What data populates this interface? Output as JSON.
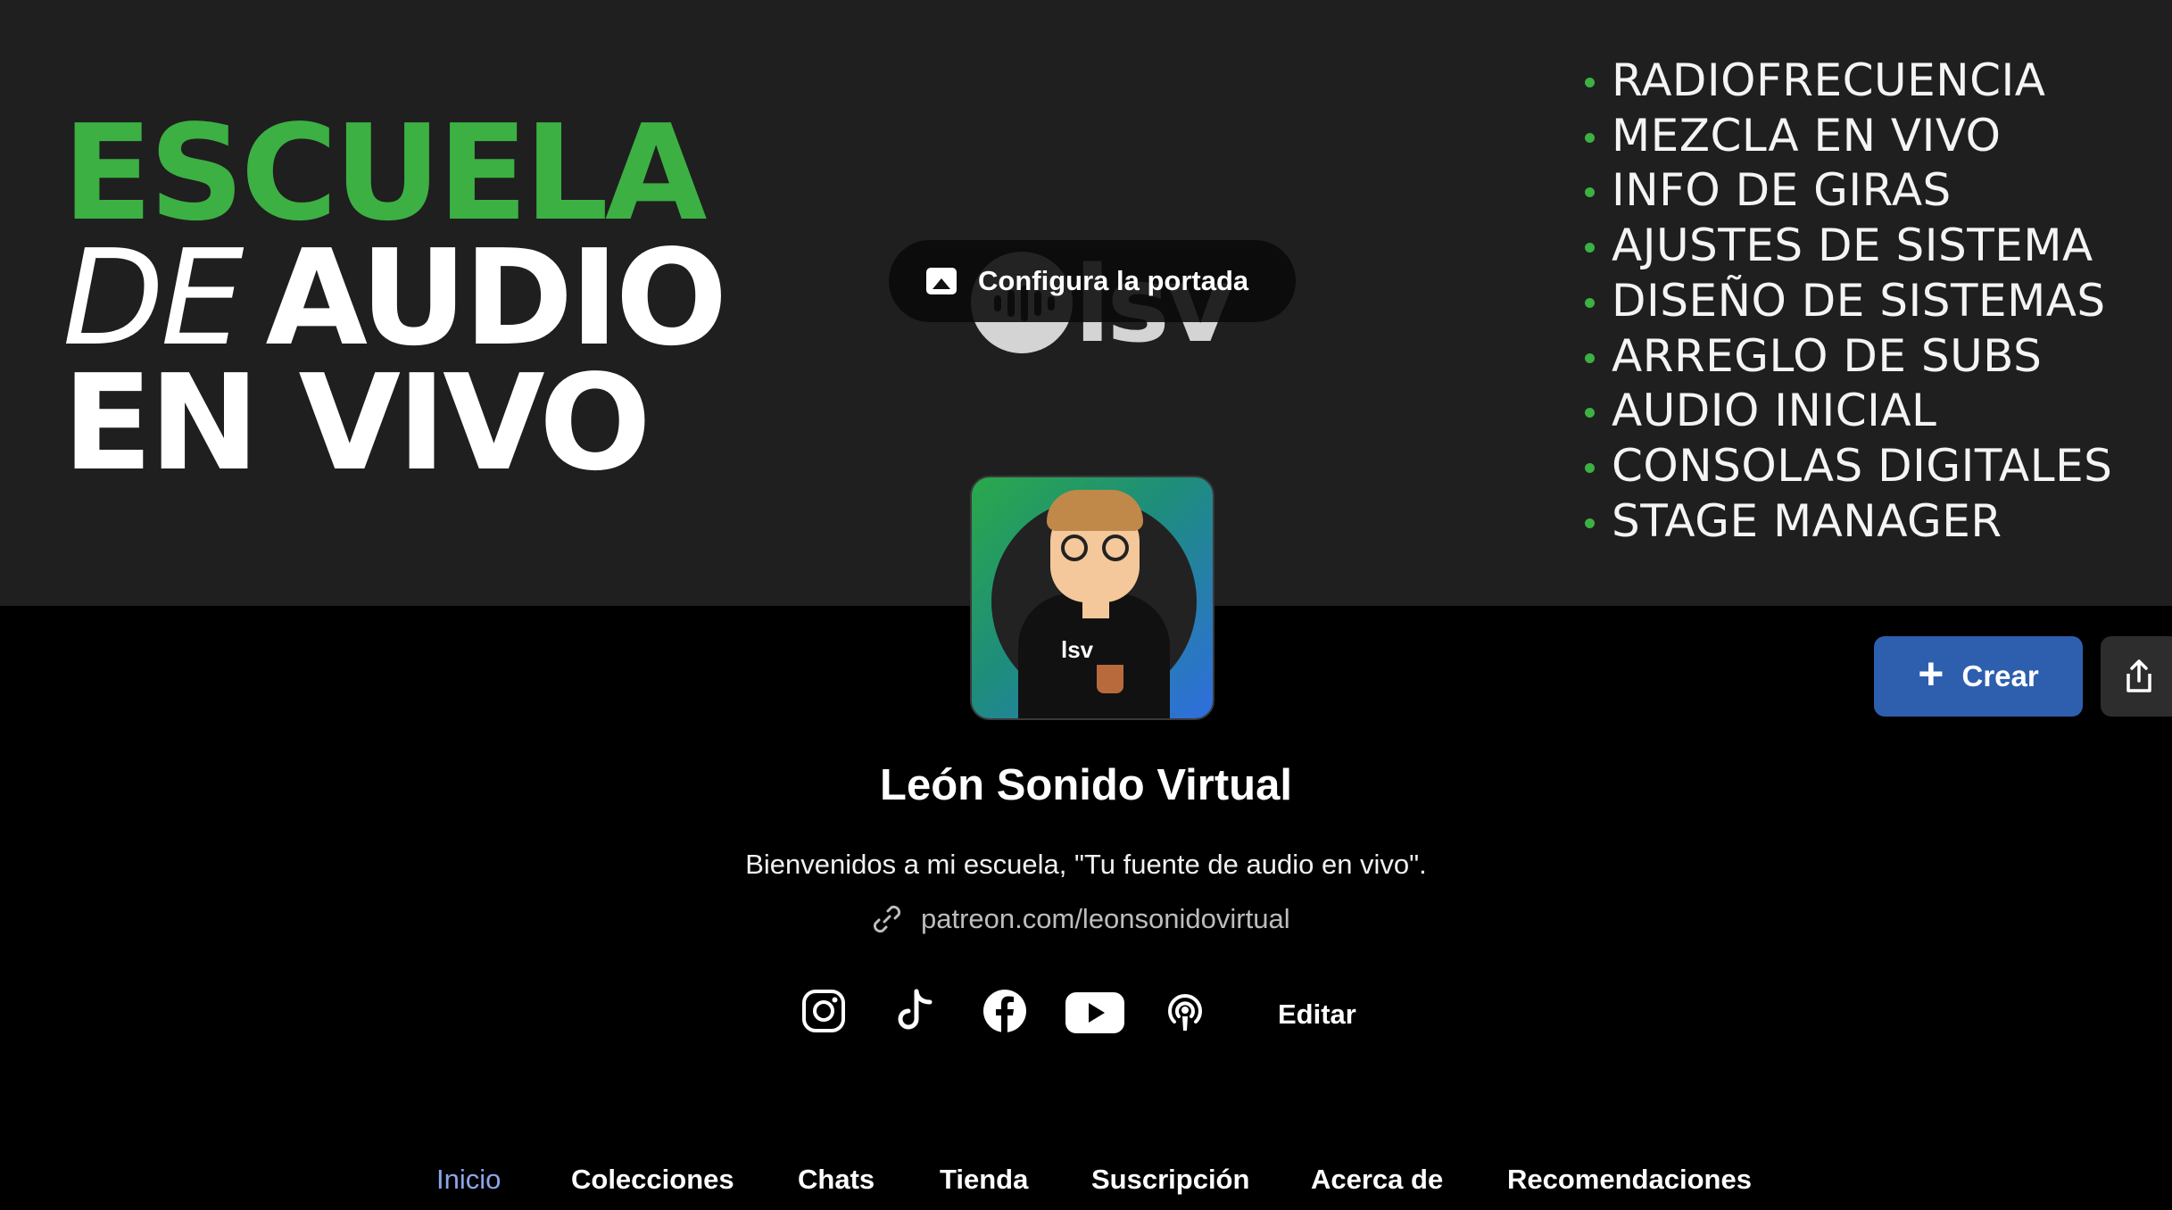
{
  "cover": {
    "title_line1": "ESCUELA",
    "title_line2_italic": "DE",
    "title_line2_rest": "AUDIO",
    "title_line3": "EN VIVO",
    "logo_text": "lsv",
    "topics": [
      "RADIOFRECUENCIA",
      "MEZCLA EN VIVO",
      "INFO DE GIRAS",
      "AJUSTES DE SISTEMA",
      "DISEÑO DE SISTEMAS",
      "ARREGLO DE SUBS",
      "AUDIO INICIAL",
      "CONSOLAS DIGITALES",
      "STAGE MANAGER"
    ],
    "configure_button": "Configura la portada",
    "accent_color": "#3cb043"
  },
  "avatar": {
    "logo_text": "lsv"
  },
  "actions": {
    "create_label": "Crear",
    "create_color": "#2e5fae"
  },
  "profile": {
    "name": "León Sonido Virtual",
    "bio": "Bienvenidos a mi escuela, \"Tu fuente de audio en vivo\".",
    "link": "patreon.com/leonsonidovirtual",
    "edit_label": "Editar",
    "socials": [
      "instagram-icon",
      "tiktok-icon",
      "facebook-icon",
      "youtube-icon",
      "podcast-icon"
    ]
  },
  "tabs": [
    {
      "label": "Inicio",
      "active": true
    },
    {
      "label": "Colecciones"
    },
    {
      "label": "Chats"
    },
    {
      "label": "Tienda"
    },
    {
      "label": "Suscripción"
    },
    {
      "label": "Acerca de"
    },
    {
      "label": "Recomendaciones"
    }
  ],
  "tab_active_color": "#8aa7ea"
}
